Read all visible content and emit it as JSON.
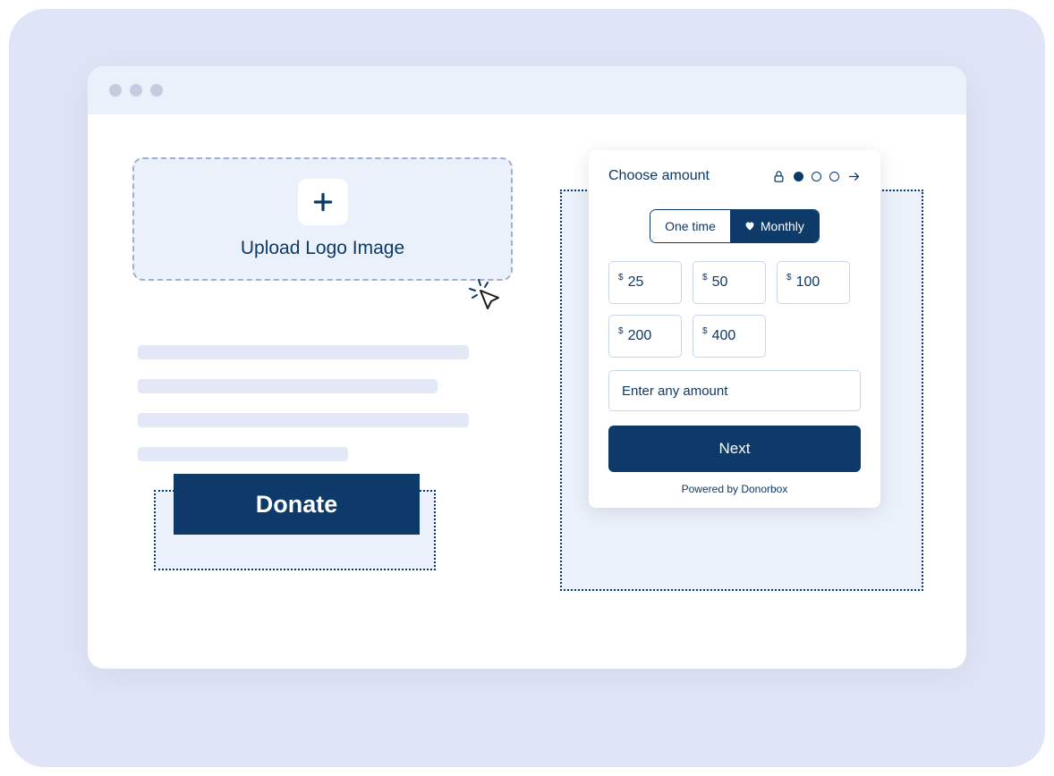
{
  "upload": {
    "label": "Upload Logo Image"
  },
  "donate_button": "Donate",
  "donation_card": {
    "title": "Choose amount",
    "frequency": {
      "one_time": "One time",
      "monthly": "Monthly"
    },
    "currency_symbol": "$",
    "amounts": [
      "25",
      "50",
      "100",
      "200",
      "400"
    ],
    "custom_placeholder": "Enter any amount",
    "next": "Next",
    "powered_by": "Powered by Donorbox"
  },
  "colors": {
    "primary": "#0d3a68",
    "border": "#c7d6ec",
    "bg_soft": "#eaf1fb"
  }
}
